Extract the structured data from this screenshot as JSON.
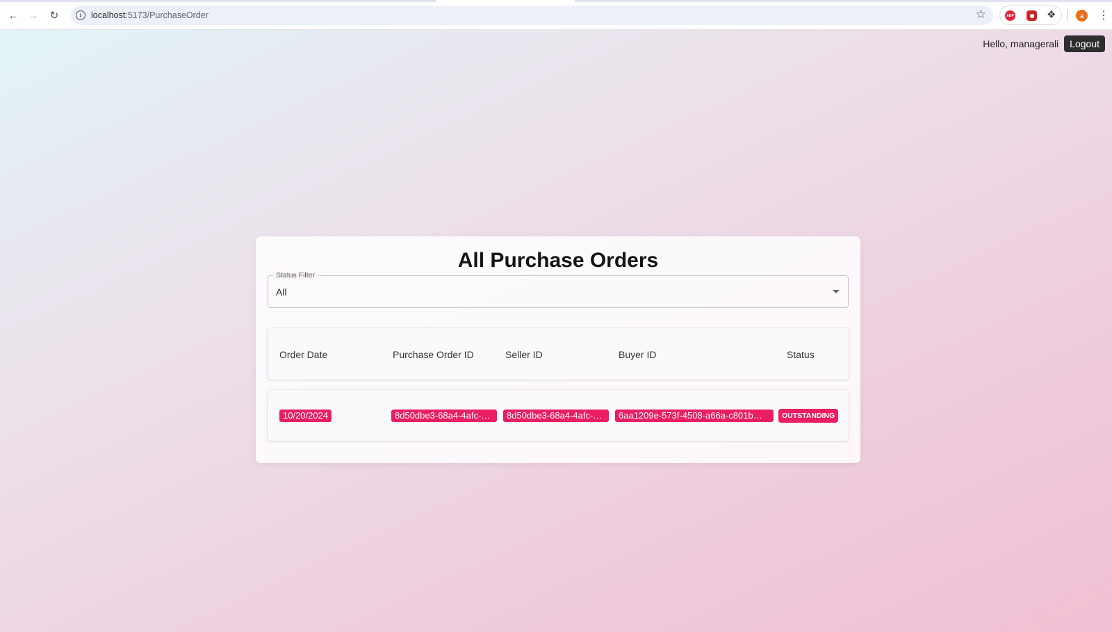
{
  "browser": {
    "url_host": "localhost",
    "url_path": ":5173/PurchaseOrder",
    "icons": {
      "back": "back-arrow-icon",
      "forward": "forward-arrow-icon",
      "reload": "reload-icon",
      "site_info": "info-icon",
      "bookmark": "star-icon",
      "adblock": "abp-extension-icon",
      "shield": "shield-extension-icon",
      "extensions": "puzzle-icon",
      "menu": "kebab-menu-icon"
    },
    "profile_initial": "a"
  },
  "header": {
    "greeting": "Hello, managerali",
    "logout_label": "Logout"
  },
  "main": {
    "title": "All Purchase Orders",
    "status_filter": {
      "label": "Status Filter",
      "value": "All"
    },
    "table": {
      "columns": [
        "Order Date",
        "Purchase Order ID",
        "Seller ID",
        "Buyer ID",
        "Status"
      ],
      "rows": [
        {
          "order_date": "10/20/2024",
          "purchase_order_id": "8d50dbe3-68a4-4afc-…",
          "seller_id": "8d50dbe3-68a4-4afc-…",
          "buyer_id": "6aa1209e-573f-4508-a66a-c801b…",
          "status": "OUTSTANDING"
        }
      ]
    }
  },
  "colors": {
    "accent": "#e91e63",
    "logout_bg": "#2d2d2d"
  }
}
